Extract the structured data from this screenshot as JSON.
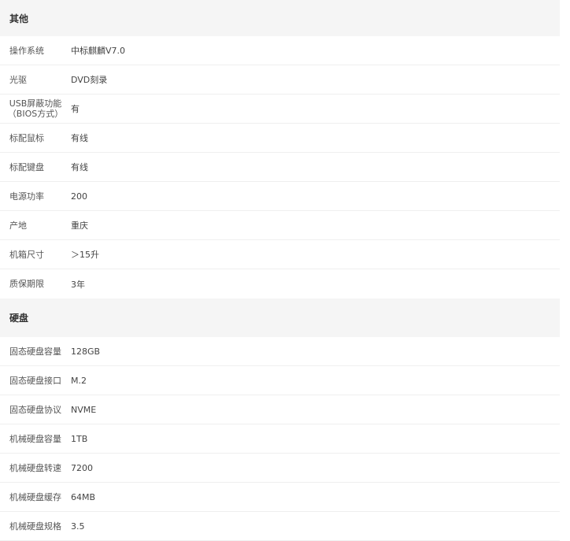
{
  "sections": [
    {
      "title": "其他",
      "rows": [
        {
          "label": "操作系统",
          "value": "中标麒麟V7.0"
        },
        {
          "label": "光驱",
          "value": "DVD刻录"
        },
        {
          "label_line1": "USB屏蔽功能",
          "label_line2": "（BIOS方式）",
          "value": "有"
        },
        {
          "label": "标配鼠标",
          "value": "有线"
        },
        {
          "label": "标配键盘",
          "value": "有线"
        },
        {
          "label": "电源功率",
          "value": "200"
        },
        {
          "label": "产地",
          "value": "重庆"
        },
        {
          "label": "机箱尺寸",
          "value": "＞15升"
        },
        {
          "label": "质保期限",
          "value": "3年"
        }
      ]
    },
    {
      "title": "硬盘",
      "rows": [
        {
          "label": "固态硬盘容量",
          "value": "128GB"
        },
        {
          "label": "固态硬盘接口",
          "value": "M.2"
        },
        {
          "label": "固态硬盘协议",
          "value": "NVME"
        },
        {
          "label": "机械硬盘容量",
          "value": "1TB"
        },
        {
          "label": "机械硬盘转速",
          "value": "7200"
        },
        {
          "label": "机械硬盘缓存",
          "value": "64MB"
        },
        {
          "label": "机械硬盘规格",
          "value": "3.5"
        }
      ]
    }
  ]
}
